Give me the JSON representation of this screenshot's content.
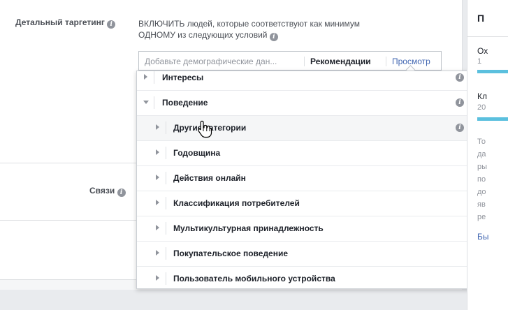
{
  "detailed_targeting": {
    "label": "Детальный таргетинг",
    "description_line1": "ВКЛЮЧИТЬ людей, которые соответствуют как минимум",
    "description_line2": "ОДНОМУ из следующих условий",
    "search_placeholder": "Добавьте демографические дан...",
    "recommendations": "Рекомендации",
    "browse": "Просмотр"
  },
  "connections": {
    "label": "Связи"
  },
  "dropdown": {
    "items": [
      {
        "label": "Интересы",
        "level": 0,
        "expanded": false,
        "info": true
      },
      {
        "label": "Поведение",
        "level": 0,
        "expanded": true,
        "info": true
      },
      {
        "label": "Другие категории",
        "level": 1,
        "info": true,
        "highlighted": true
      },
      {
        "label": "Годовщина",
        "level": 1
      },
      {
        "label": "Действия онлайн",
        "level": 1
      },
      {
        "label": "Классификация потребителей",
        "level": 1
      },
      {
        "label": "Мультикультурная принадлежность",
        "level": 1
      },
      {
        "label": "Покупательское поведение",
        "level": 1
      },
      {
        "label": "Пользователь мобильного устройства",
        "level": 1
      }
    ]
  },
  "side_panel": {
    "title": "П",
    "line1": "Ох",
    "line2": "1",
    "line3": "Кл",
    "line4": "20",
    "body": [
      "То",
      "да",
      "ры",
      "по",
      "до",
      "яв",
      "ре"
    ],
    "link": "Бы"
  },
  "colors": {
    "accent": "#4267b2",
    "bar": "#5bc0de"
  }
}
